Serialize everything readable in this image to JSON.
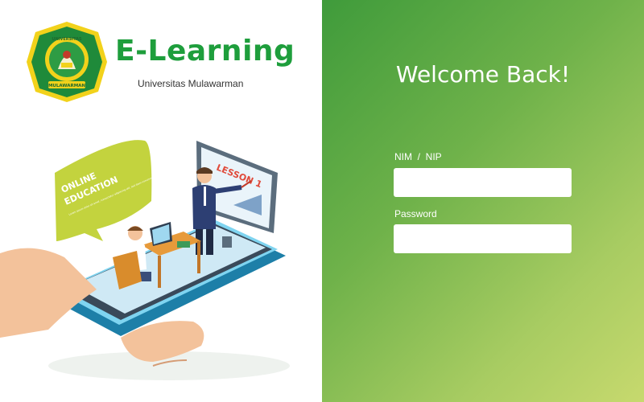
{
  "brand": {
    "title": "E-Learning",
    "subtitle": "Universitas Mulawarman",
    "logo_icon": "university-seal-icon",
    "logo_ring_text": "UNIVERSITAS",
    "logo_band_text": "MULAWARMAN",
    "colors": {
      "title": "#1e9e3c",
      "seal_green": "#1f8a3a",
      "seal_yellow": "#f2d21b"
    }
  },
  "illustration": {
    "icon": "online-education-phone-illustration",
    "bubble_title_1": "ONLINE",
    "bubble_title_2": "EDUCATION",
    "bubble_body": "Lorem ipsum dolor sit amet, consectetur adipiscing elit, sed diam nonummy nibh euismod tincidunt ut laoreet dolore magna.",
    "board_text": "LESSON 1"
  },
  "login": {
    "heading": "Welcome Back!",
    "username_label": "NIM  /  NIP",
    "username_value": "",
    "password_label": "Password",
    "password_value": "",
    "panel_gradient": [
      "#3f9b3b",
      "#c7d96e"
    ]
  }
}
